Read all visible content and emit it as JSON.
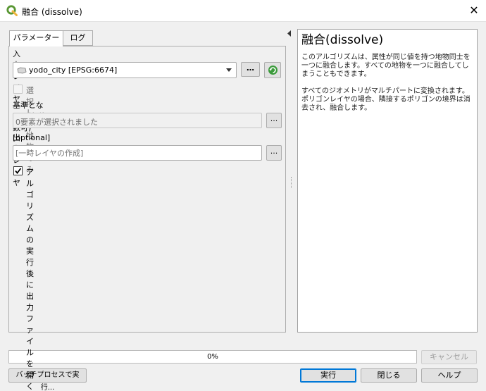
{
  "window": {
    "title": "融合 (dissolve)",
    "close_symbol": "✕"
  },
  "tabs": [
    {
      "label": "パラメーター",
      "active": true
    },
    {
      "label": "ログ",
      "active": false
    }
  ],
  "params": {
    "input_layer_label": "入力レイヤ",
    "input_layer_value": "yodo_city [EPSG:6674]",
    "more_button": "…",
    "selected_only_label": "選択した地物のみ",
    "selected_only_checked": false,
    "dissolve_field_label": "基準となる属性(複数可) [optional]",
    "dissolve_field_value": "0要素が選択されました",
    "field_button": "...",
    "output_label": "出力レイヤ",
    "output_placeholder": "[一時レイヤの作成]",
    "output_button": "...",
    "open_output_label": "アルゴリズムの実行後に出力ファイルを開く",
    "open_output_checked": true
  },
  "help": {
    "title": "融合(dissolve)",
    "paragraph1": "このアルゴリズムは、属性が同じ値を持つ地物同士を一つに融合します。すべての地物を一つに融合してしまうこともできます。",
    "paragraph2": "すべてのジオメトリがマルチパートに変換されます。ポリゴンレイヤの場合、隣接するポリゴンの境界は消去され、融合します。"
  },
  "progress": {
    "percent": 0,
    "label": "0%"
  },
  "buttons": {
    "cancel": "キャンセル",
    "batch": "バッチプロセスで実行...",
    "run": "実行",
    "close": "閉じる",
    "help": "ヘルプ"
  },
  "colors": {
    "qgis_green": "#589632",
    "qgis_yellow": "#eeb33c",
    "accent": "#0078d7"
  }
}
